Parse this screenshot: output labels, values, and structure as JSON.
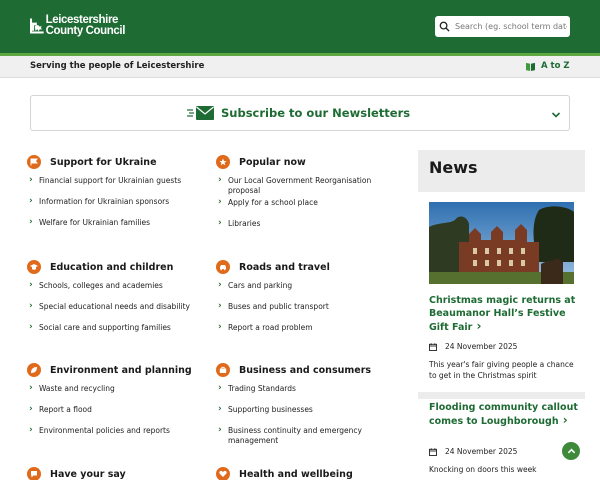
{
  "header": {
    "logo_line1": "Leicestershire",
    "logo_line2": "County Council",
    "search_placeholder": "Search (eg. school term dates)"
  },
  "subbar": {
    "tagline": "Serving the people of Leicestershire",
    "atoz_label": "A to Z"
  },
  "newsletter": {
    "label": "Subscribe to our Newsletters"
  },
  "categories": {
    "ukraine": {
      "title": "Support for Ukraine",
      "icon": "flag-icon",
      "items": [
        "Financial support for Ukrainian guests",
        "Information for Ukrainian sponsors",
        "Welfare for Ukrainian families"
      ]
    },
    "popular": {
      "title": "Popular now",
      "icon": "star-icon",
      "items": [
        "Our Local Government Reorganisation proposal",
        "Apply for a school place",
        "Libraries"
      ]
    },
    "education": {
      "title": "Education and children",
      "icon": "graduation-cap-icon",
      "items": [
        "Schools, colleges and academies",
        "Special educational needs and disability",
        "Social care and supporting families"
      ]
    },
    "roads": {
      "title": "Roads and travel",
      "icon": "car-icon",
      "items": [
        "Cars and parking",
        "Buses and public transport",
        "Report a road problem"
      ]
    },
    "environment": {
      "title": "Environment and planning",
      "icon": "leaf-icon",
      "items": [
        "Waste and recycling",
        "Report a flood",
        "Environmental policies and reports"
      ]
    },
    "business": {
      "title": "Business and consumers",
      "icon": "briefcase-icon",
      "items": [
        "Trading Standards",
        "Supporting businesses",
        "Business continuity and emergency management"
      ]
    },
    "haveyoursay": {
      "title": "Have your say",
      "icon": "speech-bubble-icon"
    },
    "health": {
      "title": "Health and wellbeing",
      "icon": "heart-icon"
    }
  },
  "news": {
    "title": "News",
    "articles": [
      {
        "title": "Christmas magic returns at Beaumanor Hall’s Festive Gift Fair",
        "date": "24 November 2025",
        "description": "This year's fair giving people a chance to get in the Christmas spirit"
      },
      {
        "title": "Flooding community callout comes to Loughborough",
        "date": "24 November 2025",
        "description": "Knocking on doors this week"
      }
    ]
  },
  "colors": {
    "brand_green": "#1e6b34",
    "accent_orange": "#e06a1b",
    "news_bg": "#ececec"
  }
}
